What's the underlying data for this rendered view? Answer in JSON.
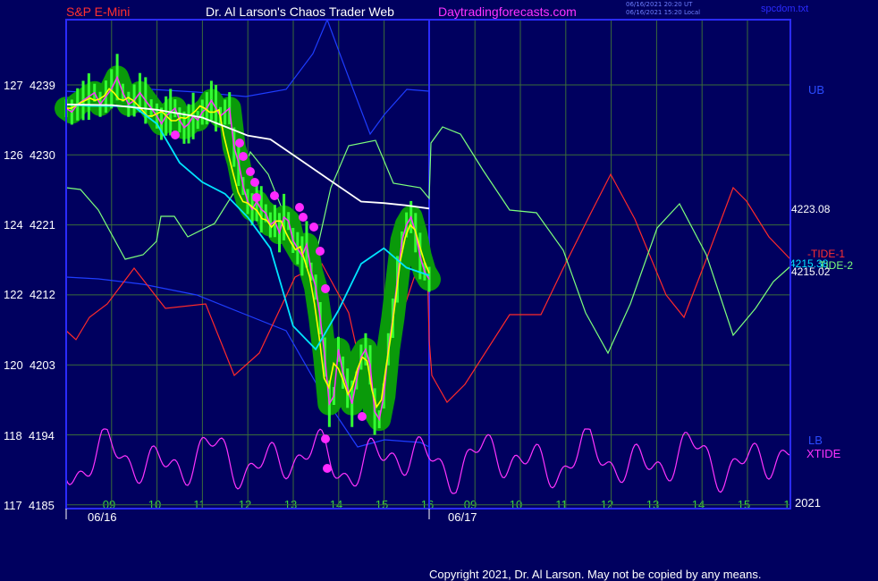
{
  "header": {
    "symbol": "S&P E-Mini",
    "title": "Dr. Al Larson's Chaos Trader Web",
    "site": "Daytradingforecasts.com",
    "stamp_ut": "06/16/2021 20:20 UT",
    "stamp_local": "06/16/2021 15:20 Local",
    "file": "spcdom.txt",
    "copyright": "Copyright 2021, Dr. Al Larson. May not be copied by any means."
  },
  "colors": {
    "background": "#00005f",
    "frame": "#2b2bff",
    "grid": "#3a6b3a",
    "price_band": "#0a9a0a",
    "price_bar": "#33ff33",
    "price_line": "#ff33ff",
    "avg_fast": "#ffff00",
    "avg_slow": "#00e5ff",
    "avg_long": "#ffffff",
    "ub": "#1e3dff",
    "tide1": "#ff2a2a",
    "tide2": "#7cff7c",
    "xtide": "#ff33ff",
    "markers": "#ff2aff"
  },
  "chart_data": {
    "type": "line",
    "y_axis": {
      "ticks": [
        {
          "price": 4239,
          "label": "127"
        },
        {
          "price": 4230,
          "label": "126"
        },
        {
          "price": 4221,
          "label": "124"
        },
        {
          "price": 4212,
          "label": "122"
        },
        {
          "price": 4203,
          "label": "120"
        },
        {
          "price": 4194,
          "label": "118"
        },
        {
          "price": 4185,
          "label": "117"
        }
      ],
      "range": [
        4185,
        4242
      ]
    },
    "x_axis": {
      "hour_labels": [
        "09",
        "10",
        "11",
        "12",
        "13",
        "14",
        "15",
        "16",
        "09",
        "10",
        "11",
        "12",
        "13",
        "14",
        "15",
        "1"
      ],
      "date_labels": [
        "06/16",
        "06/17"
      ],
      "year_label": "2021",
      "ticks_slot_range": [
        0,
        16
      ]
    },
    "right_labels": {
      "ub": "UB",
      "lb": "LB",
      "tide1": "-TIDE-1",
      "tide2": "TIDE-2",
      "xtide": "XTIDE",
      "last_long_avg": "4223.08",
      "last_mid": "4215.38",
      "last_price": "4215.02"
    },
    "series": [
      {
        "name": "price",
        "x": [
          0,
          0.25,
          0.5,
          0.75,
          1,
          1.25,
          1.5,
          1.75,
          2,
          2.25,
          2.5,
          2.75,
          3,
          3.25,
          3.5,
          3.75,
          4,
          4.2,
          4.4,
          4.6,
          4.8,
          5,
          5.2,
          5.4,
          5.6,
          5.8,
          6,
          6.2,
          6.4,
          6.6,
          6.8,
          7,
          7.2,
          7.4,
          7.6,
          7.8,
          8,
          8.2,
          8.4,
          8.6,
          8.8,
          9,
          9.2,
          9.4,
          9.6,
          9.8,
          10,
          10.2,
          10.4,
          10.6,
          10.8,
          11,
          11.2,
          11.4,
          11.6,
          11.8,
          12,
          12.2,
          12.4,
          12.6,
          12.8,
          13,
          13.2,
          13.4,
          13.6,
          13.8,
          14,
          14.2,
          14.4,
          14.6,
          14.8,
          15,
          15.2,
          15.4,
          15.6,
          15.8,
          16
        ],
        "y": [
          4236,
          4235.5,
          4236.5,
          4237,
          4237.5,
          4238,
          4236.5,
          4237.5,
          4238.5,
          4240,
          4238,
          4236.5,
          4237,
          4238,
          4237,
          4236,
          4235,
          4234,
          4235,
          4235.5,
          4236,
          4234.5,
          4233.5,
          4234,
          4235,
          4234.5,
          4235.5,
          4236,
          4237,
          4236,
          4235,
          4235.5,
          4236,
          4231,
          4229,
          4226,
          4224,
          4223,
          4224,
          4223,
          4222.5,
          4221,
          4221.5,
          4220,
          4222,
          4221.5,
          4219,
          4218,
          4217,
          4218.5,
          4215,
          4213,
          4209,
          4204,
          4198,
          4199,
          4205,
          4202,
          4200,
          4198,
          4201,
          4204,
          4205,
          4203,
          4197,
          4196,
          4199,
          4205,
          4209,
          4214,
          4219,
          4221,
          4222,
          4220,
          4217,
          4215,
          4214
        ]
      },
      {
        "name": "fast_avg",
        "x": [
          0,
          1,
          2,
          3,
          4,
          5,
          6,
          7,
          8,
          9,
          10,
          11,
          12,
          13,
          14,
          15,
          16,
          17,
          18,
          19,
          20,
          21,
          22,
          23,
          24,
          25,
          26,
          27,
          28,
          29,
          30,
          31,
          32,
          33,
          34,
          35,
          36,
          37,
          38,
          39,
          40,
          41,
          42,
          43,
          44,
          45,
          46,
          47,
          48,
          49,
          50,
          51,
          52,
          53,
          54,
          55,
          56,
          57,
          58,
          59,
          60,
          61,
          62,
          63,
          64,
          65,
          66,
          67,
          68,
          69,
          70,
          71,
          72,
          73,
          74,
          75,
          76
        ],
        "y": [
          4236,
          4236,
          4236.3,
          4236.7,
          4237,
          4237.3,
          4237,
          4237.2,
          4237.6,
          4238.5,
          4238,
          4237.2,
          4237,
          4237.4,
          4237,
          4236.4,
          4235.7,
          4235,
          4235,
          4235.3,
          4235.6,
          4235,
          4234.4,
          4234.4,
          4234.8,
          4234.7,
          4235.1,
          4235.6,
          4236.3,
          4236,
          4235.5,
          4235.5,
          4235.8,
          4232.5,
          4230,
          4227.5,
          4225.2,
          4224,
          4223.8,
          4223.3,
          4222.8,
          4221.8,
          4221.6,
          4220.7,
          4221.5,
          4221.5,
          4220,
          4218.8,
          4217.8,
          4218.2,
          4216.3,
          4214.3,
          4210.8,
          4206.5,
          4201.3,
          4200.1,
          4203.2,
          4202.5,
          4201,
          4199.2,
          4200.3,
          4202.5,
          4204,
          4203.5,
          4199.8,
          4197.6,
          4198.5,
          4202.8,
          4206.8,
          4211.5,
          4216.5,
          4219.4,
          4221,
          4220.4,
          4218.3,
          4216.3,
          4214.8
        ]
      },
      {
        "name": "slow_avg",
        "x": [
          0,
          1,
          2,
          3,
          4,
          5,
          6,
          7,
          8,
          9,
          10,
          11,
          12,
          13,
          14,
          15,
          16
        ],
        "y": [
          4236.5,
          4236.3,
          4236.3,
          4236.2,
          4234,
          4229,
          4226.5,
          4225,
          4222,
          4218,
          4208,
          4205,
          4210,
          4216,
          4218,
          4215.5,
          4214.5
        ]
      },
      {
        "name": "long_avg",
        "x": [
          0,
          2,
          4,
          6,
          8,
          9,
          10,
          12,
          13,
          14,
          15,
          16
        ],
        "y": [
          4236.5,
          4236.4,
          4235.8,
          4234.8,
          4232.5,
          4232,
          4230,
          4226,
          4224,
          4223.8,
          4223.5,
          4223.1
        ]
      }
    ]
  }
}
